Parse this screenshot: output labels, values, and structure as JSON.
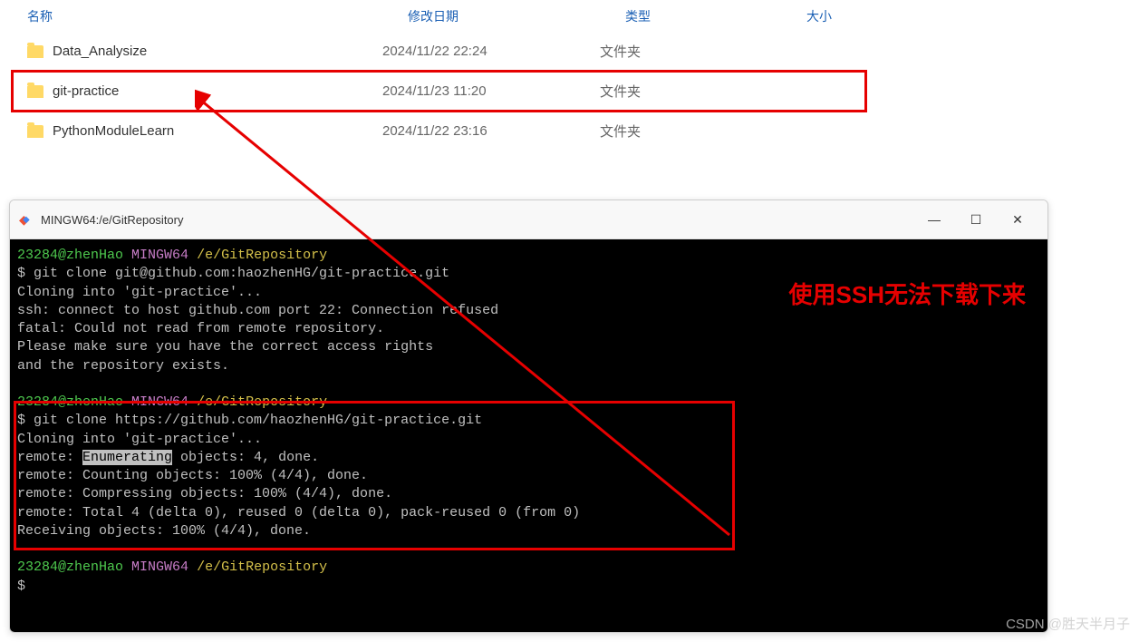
{
  "explorer": {
    "headers": {
      "name": "名称",
      "date": "修改日期",
      "type": "类型",
      "size": "大小"
    },
    "rows": [
      {
        "name": "Data_Analysize",
        "date": "2024/11/22 22:24",
        "type": "文件夹",
        "highlighted": false
      },
      {
        "name": "git-practice",
        "date": "2024/11/23 11:20",
        "type": "文件夹",
        "highlighted": true
      },
      {
        "name": "PythonModuleLearn",
        "date": "2024/11/22 23:16",
        "type": "文件夹",
        "highlighted": false
      }
    ]
  },
  "terminal": {
    "title": "MINGW64:/e/GitRepository",
    "prompt": {
      "user": "23284@zhenHao",
      "host": "MINGW64",
      "path": "/e/GitRepository"
    },
    "block1": {
      "cmd": "$ git clone git@github.com:haozhenHG/git-practice.git",
      "l1": "Cloning into 'git-practice'...",
      "l2": "ssh: connect to host github.com port 22: Connection refused",
      "l3": "fatal: Could not read from remote repository.",
      "l4": "",
      "l5": "Please make sure you have the correct access rights",
      "l6": "and the repository exists."
    },
    "block2": {
      "cmd": "$ git clone https://github.com/haozhenHG/git-practice.git",
      "l1": "Cloning into 'git-practice'...",
      "l2a": "remote: ",
      "l2b": "Enumerating",
      "l2c": " objects: 4, done.",
      "l3": "remote: Counting objects: 100% (4/4), done.",
      "l4": "remote: Compressing objects: 100% (4/4), done.",
      "l5": "remote: Total 4 (delta 0), reused 0 (delta 0), pack-reused 0 (from 0)",
      "l6": "Receiving objects: 100% (4/4), done."
    },
    "final_prompt": "$"
  },
  "annotation": "使用SSH无法下载下来",
  "watermark": "CSDN @胜天半月子",
  "win_controls": {
    "min": "—",
    "max": "☐",
    "close": "✕"
  }
}
